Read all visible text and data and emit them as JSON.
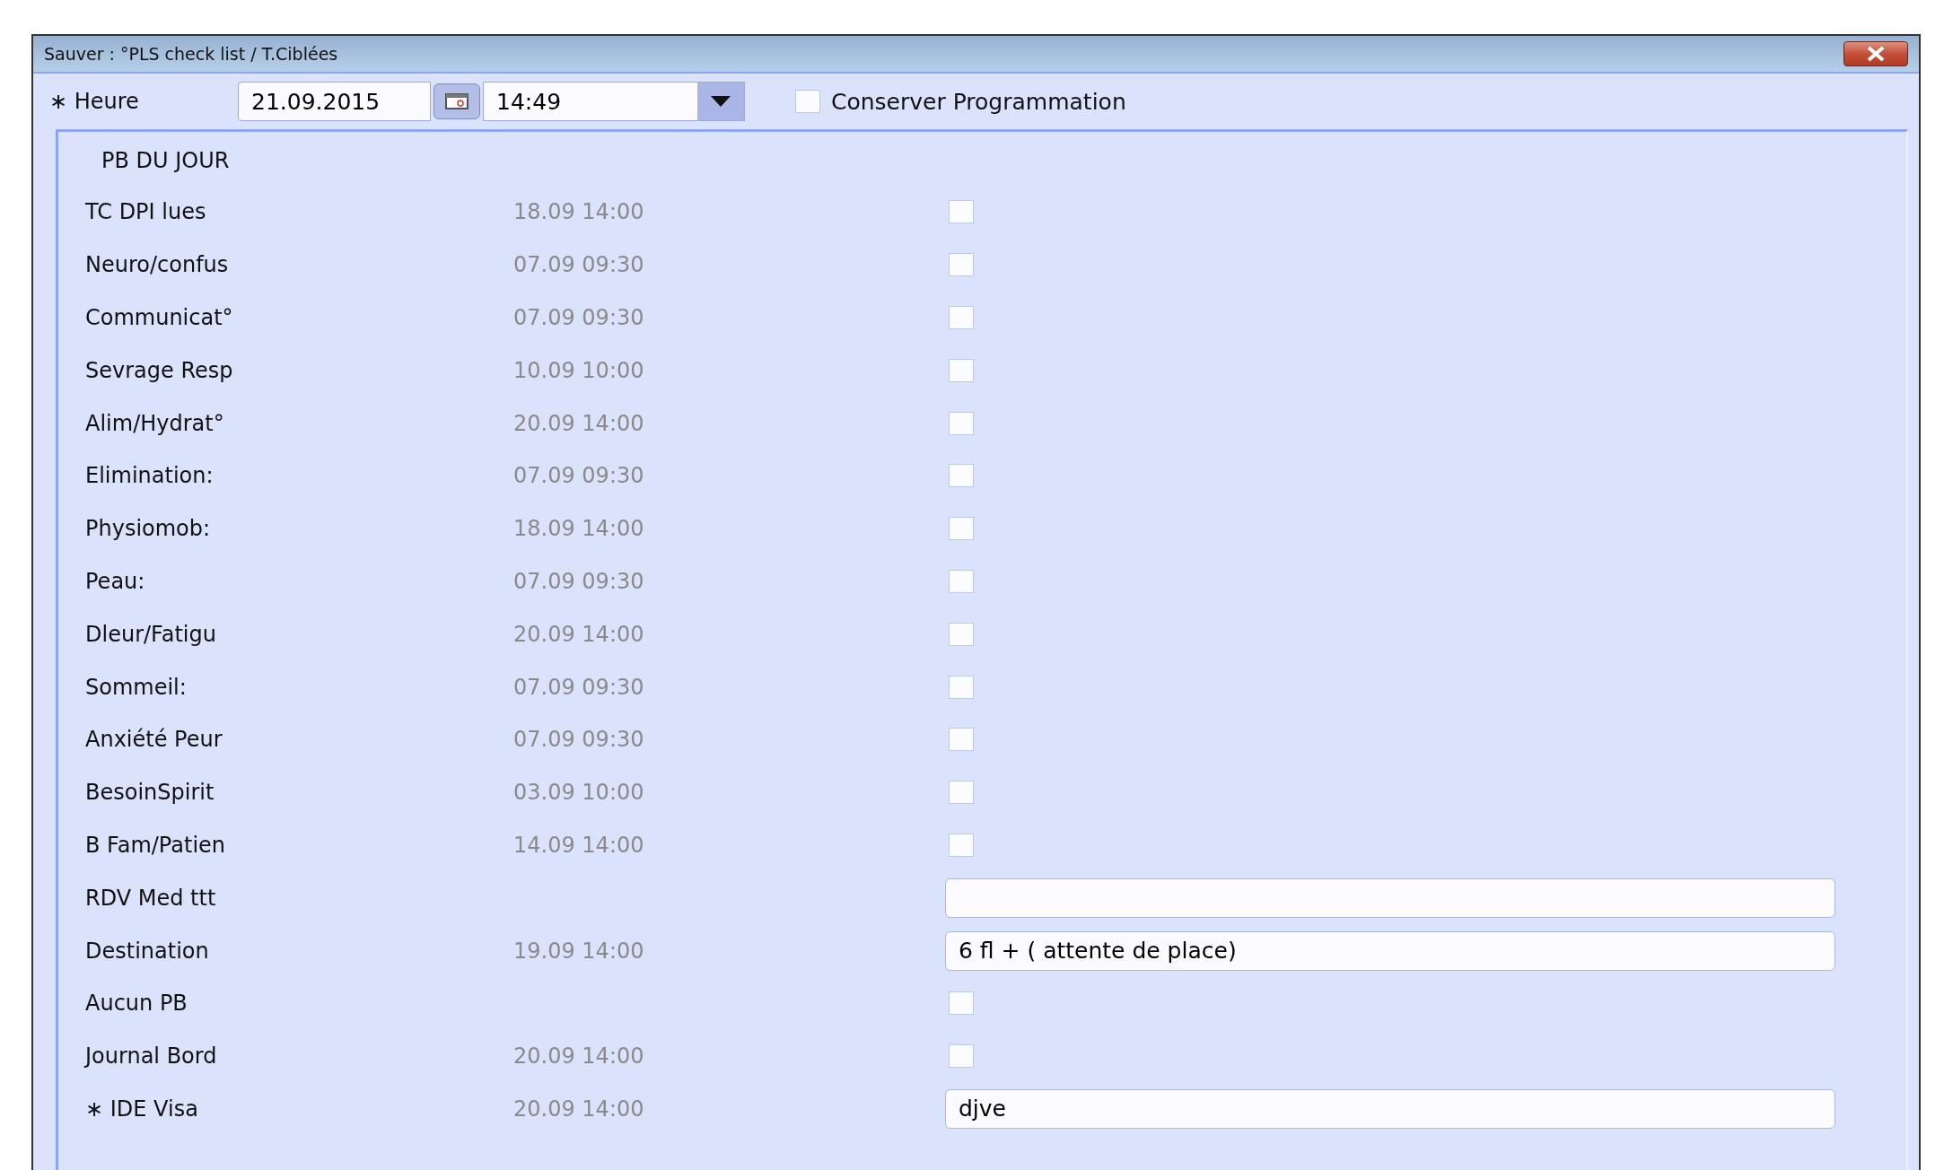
{
  "window": {
    "title": "Sauver : °PLS check list / T.Ciblées"
  },
  "header": {
    "label": "∗ Heure",
    "date": "21.09.2015",
    "time": "14:49",
    "keep_schedule": {
      "label": "Conserver Programmation",
      "checked": false
    }
  },
  "section": {
    "title": "PB DU JOUR"
  },
  "rows": [
    {
      "label": "TC DPI lues",
      "date": "18.09 14:00",
      "kind": "checkbox",
      "checked": false
    },
    {
      "label": "Neuro/confus",
      "date": "07.09 09:30",
      "kind": "checkbox",
      "checked": false
    },
    {
      "label": "Communicat°",
      "date": "07.09 09:30",
      "kind": "checkbox",
      "checked": false
    },
    {
      "label": "Sevrage Resp",
      "date": "10.09 10:00",
      "kind": "checkbox",
      "checked": false
    },
    {
      "label": "Alim/Hydrat°",
      "date": "20.09 14:00",
      "kind": "checkbox",
      "checked": false
    },
    {
      "label": "Elimination:",
      "date": "07.09 09:30",
      "kind": "checkbox",
      "checked": false
    },
    {
      "label": "Physiomob:",
      "date": "18.09 14:00",
      "kind": "checkbox",
      "checked": false
    },
    {
      "label": "Peau:",
      "date": "07.09 09:30",
      "kind": "checkbox",
      "checked": false
    },
    {
      "label": "Dleur/Fatigu",
      "date": "20.09 14:00",
      "kind": "checkbox",
      "checked": false
    },
    {
      "label": "Sommeil:",
      "date": "07.09 09:30",
      "kind": "checkbox",
      "checked": false
    },
    {
      "label": "Anxiété Peur",
      "date": "07.09 09:30",
      "kind": "checkbox",
      "checked": false
    },
    {
      "label": "BesoinSpirit",
      "date": "03.09 10:00",
      "kind": "checkbox",
      "checked": false
    },
    {
      "label": "B Fam/Patien",
      "date": "14.09 14:00",
      "kind": "checkbox",
      "checked": false
    },
    {
      "label": "RDV Med ttt",
      "kind": "text"
    },
    {
      "label": "Destination",
      "date": "19.09 14:00",
      "kind": "text",
      "value": "6 fl + ( attente de place)"
    },
    {
      "label": "Aucun PB",
      "kind": "checkbox",
      "checked": false
    },
    {
      "label": "Journal Bord",
      "date": "20.09 14:00",
      "kind": "checkbox",
      "checked": false
    },
    {
      "label": "∗ IDE Visa",
      "date": "20.09 14:00",
      "kind": "text",
      "value": "djve"
    }
  ]
}
